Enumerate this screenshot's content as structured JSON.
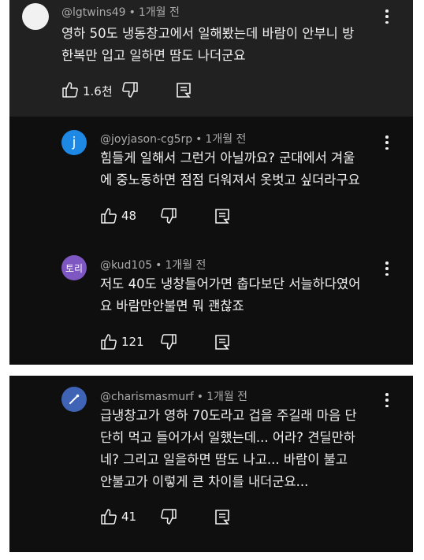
{
  "comments": [
    {
      "author": "@lgtwins49",
      "time": "1개월 전",
      "lines": [
        "영하 50도 냉동창고에서 일해봤는데 바람이 안부니 방",
        "한복만 입고  일하면 땀도 나더군요"
      ],
      "likes": "1.6천",
      "avatar_color": "#f1f1f1",
      "avatar_text": ""
    },
    {
      "author": "@joyjason-cg5rp",
      "time": "1개월 전",
      "lines": [
        "힘들게 일해서 그런거 아닐까요? 군대에서 겨울",
        "에 중노동하면 점점 더워져서 옷벗고 싶더라구요"
      ],
      "likes": "48",
      "avatar_color": "#1e88e5",
      "avatar_text": "j"
    },
    {
      "author": "@kud105",
      "time": "1개월 전",
      "lines": [
        "저도 40도 냉창들어가면 춥다보단 서늘하다였어",
        "요 바람만안불면 뭐 괜찮죠"
      ],
      "likes": "121",
      "avatar_color": "#7e57c2",
      "avatar_text": "토리"
    },
    {
      "author": "@charismasmurf",
      "time": "1개월 전",
      "lines": [
        "급냉창고가 영하 70도라고 겁을 주길래 마음 단",
        "단히 먹고 들어가서 일했는데... 어라? 견딜만하",
        "네? 그리고 일을하면 땀도 나고... 바람이 불고",
        "안불고가 이렇게 큰 차이를 내더군요..."
      ],
      "likes": "41",
      "avatar_color": "#3f63b5",
      "avatar_text": ""
    }
  ]
}
